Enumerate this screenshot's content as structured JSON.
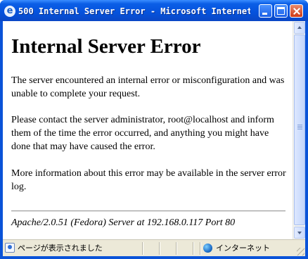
{
  "window": {
    "title": "500 Internal Server Error - Microsoft Internet E...",
    "app_icon": "ie-icon"
  },
  "page": {
    "heading": "Internal Server Error",
    "paragraphs": [
      "The server encountered an internal error or misconfiguration and was unable to complete your request.",
      "Please contact the server administrator, root@localhost and inform them of the time the error occurred, and anything you might have done that may have caused the error.",
      "More information about this error may be available in the server error log."
    ],
    "address": "Apache/2.0.51 (Fedora) Server at 192.168.0.117 Port 80"
  },
  "status": {
    "text": "ページが表示されました",
    "zone": "インターネット"
  },
  "colors": {
    "titlebar": "#0552dc",
    "statusbar": "#ece9d8",
    "close_button": "#cf3b16"
  }
}
